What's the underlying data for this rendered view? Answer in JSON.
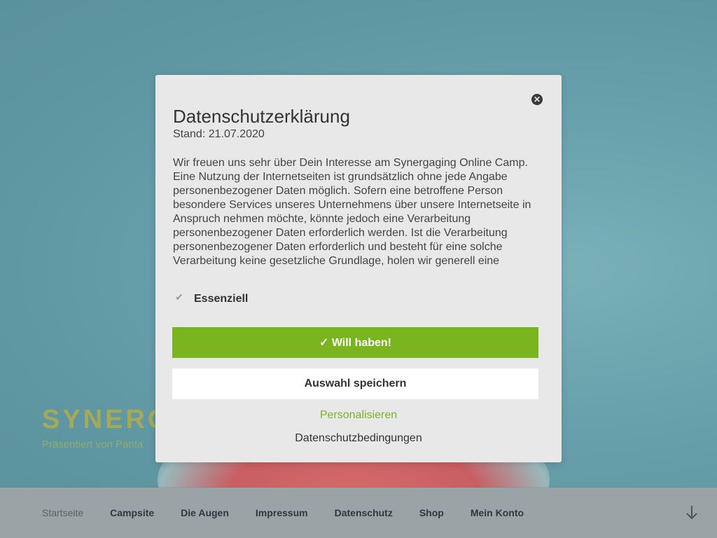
{
  "site": {
    "title": "SYNERG",
    "description": "Präsentiert von Panta"
  },
  "nav": {
    "items": [
      {
        "label": "Startseite"
      },
      {
        "label": "Campsite"
      },
      {
        "label": "Die Augen"
      },
      {
        "label": "Impressum"
      },
      {
        "label": "Datenschutz"
      },
      {
        "label": "Shop"
      },
      {
        "label": "Mein Konto"
      }
    ],
    "scroll_icon": "arrow-down-icon"
  },
  "modal": {
    "title": "Datenschutzerklärung",
    "date": "Stand: 21.07.2020",
    "body": "Wir freuen uns sehr über Dein Interesse am Synergaging Online Camp. Eine Nutzung der Internetseiten ist grundsätzlich ohne jede Angabe personenbezogener Daten möglich. Sofern eine betroffene Person besondere Services unseres Unternehmens über unsere Internetseite in Anspruch nehmen möchte, könnte jedoch eine Verarbeitung personenbezogener Daten erforderlich werden. Ist die Verarbeitung personenbezogener Daten erforderlich und besteht für eine solche Verarbeitung keine gesetzliche Grundlage, holen wir generell eine",
    "close_icon": "close-icon",
    "checkbox_label": "Essenziell",
    "checkbox_checked": true,
    "accept_label": "✓ Will haben!",
    "save_label": "Auswahl speichern",
    "personalize_label": "Personalisieren",
    "privacy_label": "Datenschutzbedingungen"
  },
  "colors": {
    "accent": "#7ab520",
    "modal_bg": "#e8e8e8",
    "hero": "#5f9aa4"
  }
}
